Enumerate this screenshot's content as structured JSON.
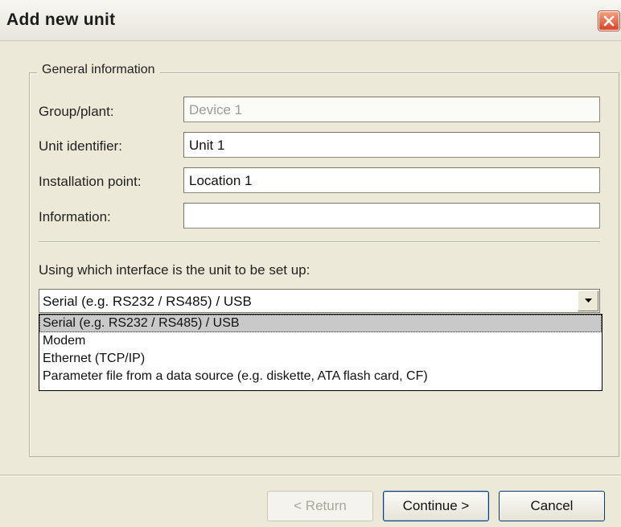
{
  "window": {
    "title": "Add new unit"
  },
  "group": {
    "legend": "General information"
  },
  "fields": [
    {
      "label": "Group/plant:",
      "value": "Device 1"
    },
    {
      "label": "Unit identifier:",
      "value": "Unit 1"
    },
    {
      "label": "Installation point:",
      "value": "Location 1"
    },
    {
      "label": "Information:",
      "value": ""
    }
  ],
  "interface": {
    "prompt": "Using which interface is the unit to be set up:",
    "selected": "Serial (e.g. RS232 / RS485) / USB",
    "options": [
      "Serial (e.g. RS232 / RS485) / USB",
      "Modem",
      "Ethernet (TCP/IP)",
      "Parameter file from a data source (e.g. diskette, ATA flash card, CF)"
    ]
  },
  "buttons": {
    "return": "< Return",
    "continue": "Continue >",
    "cancel": "Cancel"
  },
  "icons": {
    "close": "close-icon",
    "dropdown": "chevron-down-icon"
  }
}
